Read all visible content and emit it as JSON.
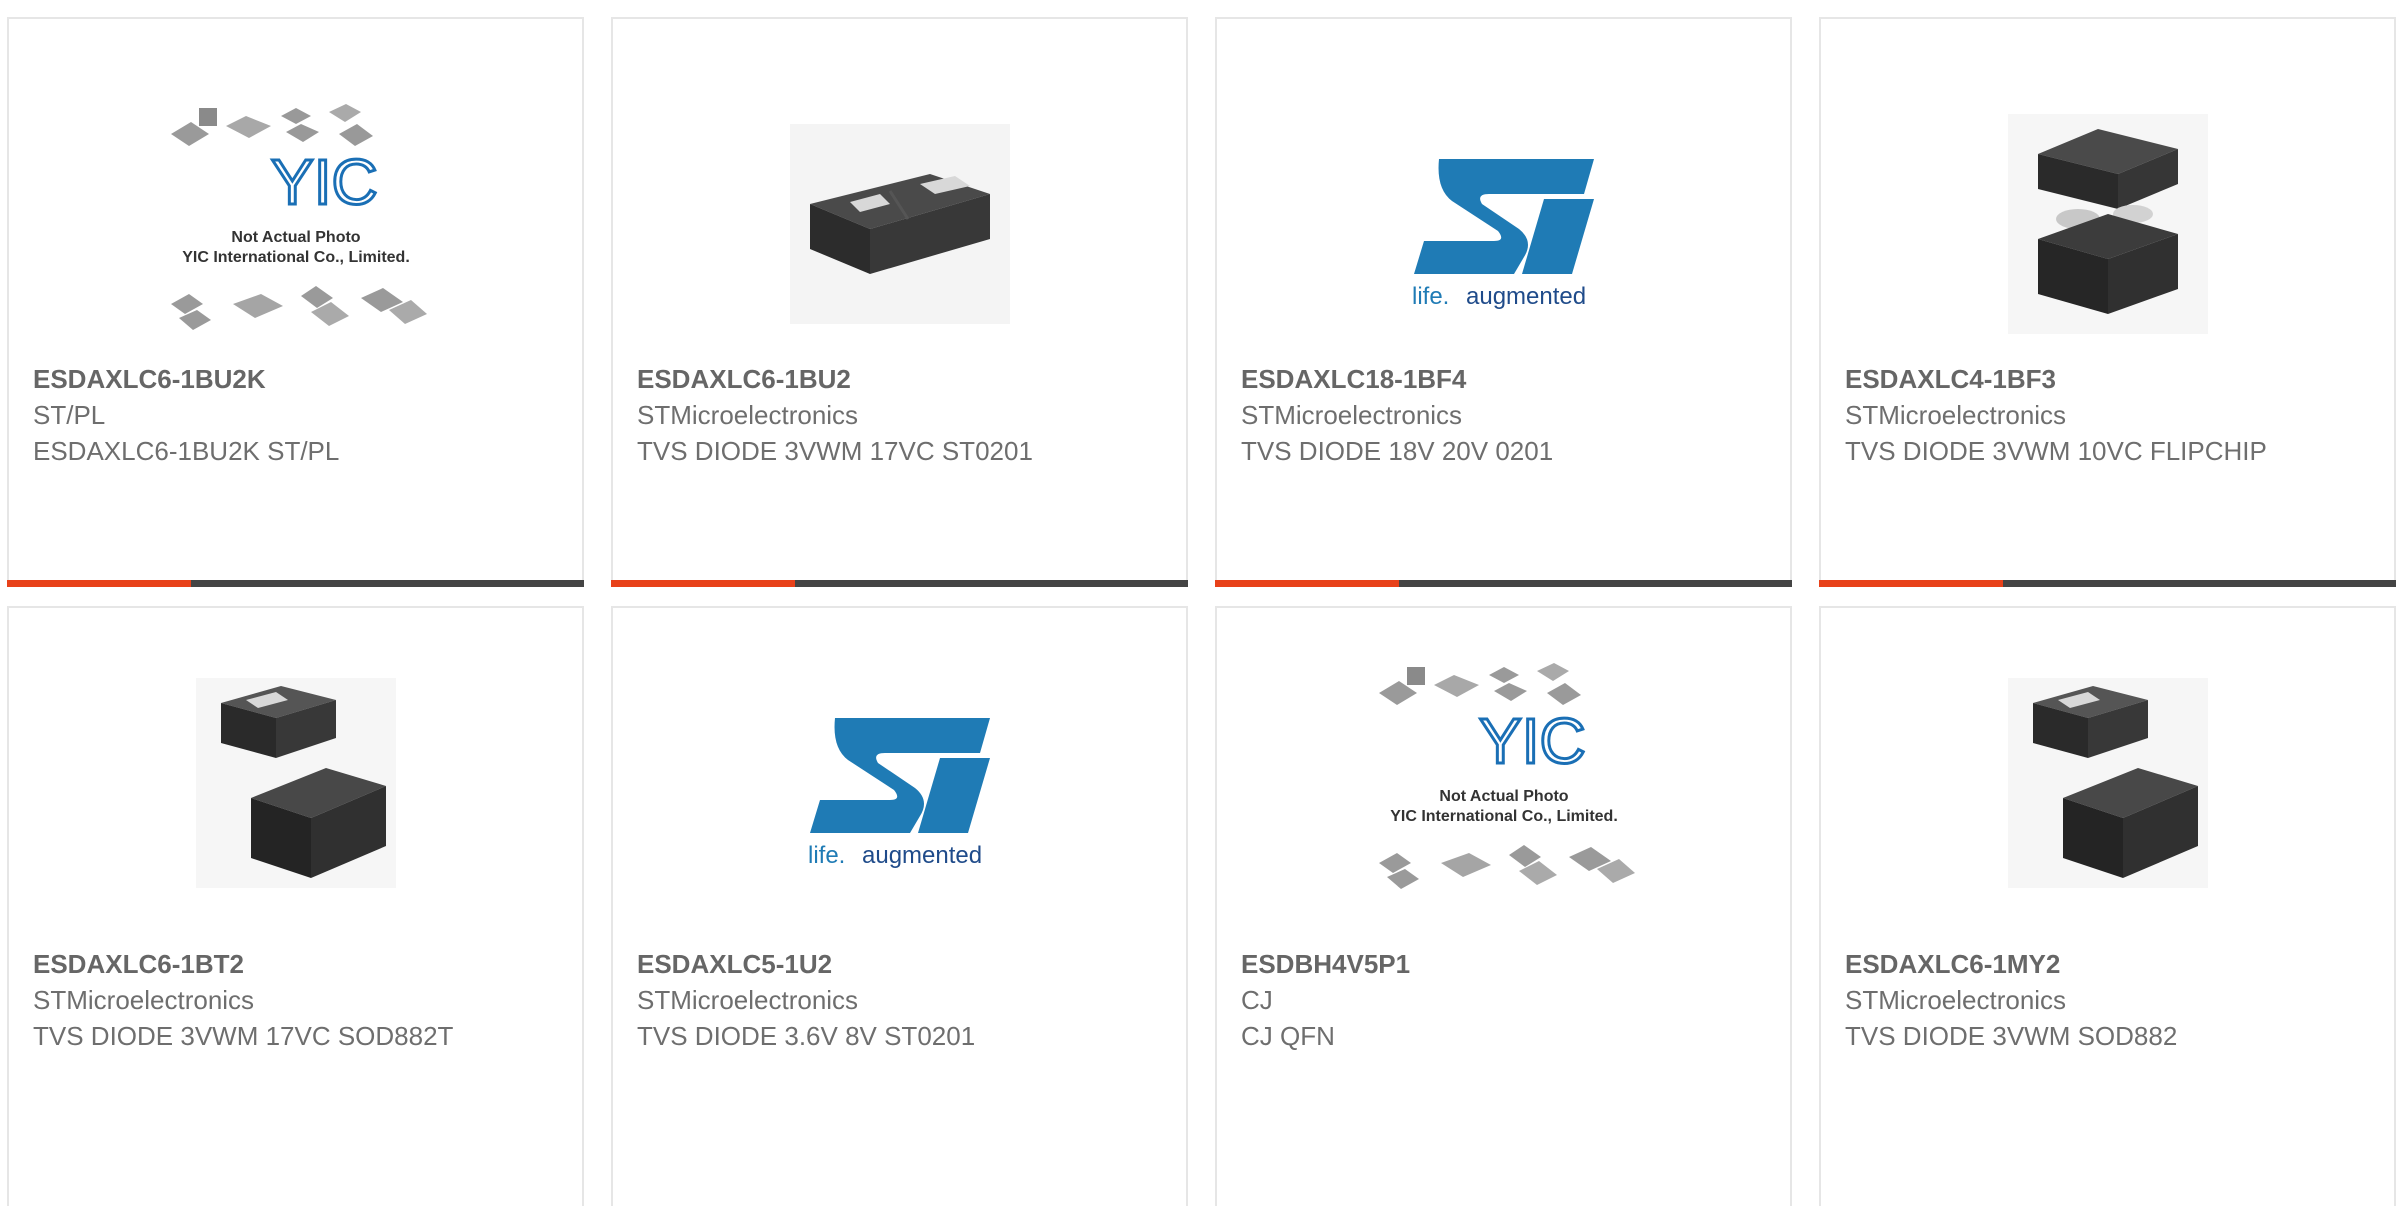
{
  "colors": {
    "accent": "#e8411a",
    "bar": "#444444",
    "st_blue": "#1f7bb5",
    "yic_blue": "#1a6fb5"
  },
  "products": [
    {
      "part": "ESDAXLC6-1BU2K",
      "manufacturer": "ST/PL",
      "description": "ESDAXLC6-1BU2K ST/PL",
      "image": "yic-placeholder-icon",
      "yic_line1": "Not Actual Photo",
      "yic_line2": "YIC International Co., Limited.",
      "yic_logo": "YIC"
    },
    {
      "part": "ESDAXLC6-1BU2",
      "manufacturer": "STMicroelectronics",
      "description": "TVS DIODE 3VWM 17VC ST0201",
      "image": "diode-chip-image"
    },
    {
      "part": "ESDAXLC18-1BF4",
      "manufacturer": "STMicroelectronics",
      "description": "TVS DIODE 18V 20V 0201",
      "image": "st-logo-icon",
      "st_tagline_a": "life.",
      "st_tagline_b": "augmented"
    },
    {
      "part": "ESDAXLC4-1BF3",
      "manufacturer": "STMicroelectronics",
      "description": "TVS DIODE 3VWM 10VC FLIPCHIP",
      "image": "flipchip-image"
    },
    {
      "part": "ESDAXLC6-1BT2",
      "manufacturer": "STMicroelectronics",
      "description": "TVS DIODE 3VWM 17VC SOD882T",
      "image": "sod882-image"
    },
    {
      "part": "ESDAXLC5-1U2",
      "manufacturer": "STMicroelectronics",
      "description": "TVS DIODE 3.6V 8V ST0201",
      "image": "st-logo-icon",
      "st_tagline_a": "life.",
      "st_tagline_b": "augmented"
    },
    {
      "part": "ESDBH4V5P1",
      "manufacturer": "CJ",
      "description": "CJ QFN",
      "image": "yic-placeholder-icon",
      "yic_line1": "Not Actual Photo",
      "yic_line2": "YIC International Co., Limited.",
      "yic_logo": "YIC"
    },
    {
      "part": "ESDAXLC6-1MY2",
      "manufacturer": "STMicroelectronics",
      "description": "TVS DIODE 3VWM SOD882",
      "image": "sod882-image"
    }
  ]
}
